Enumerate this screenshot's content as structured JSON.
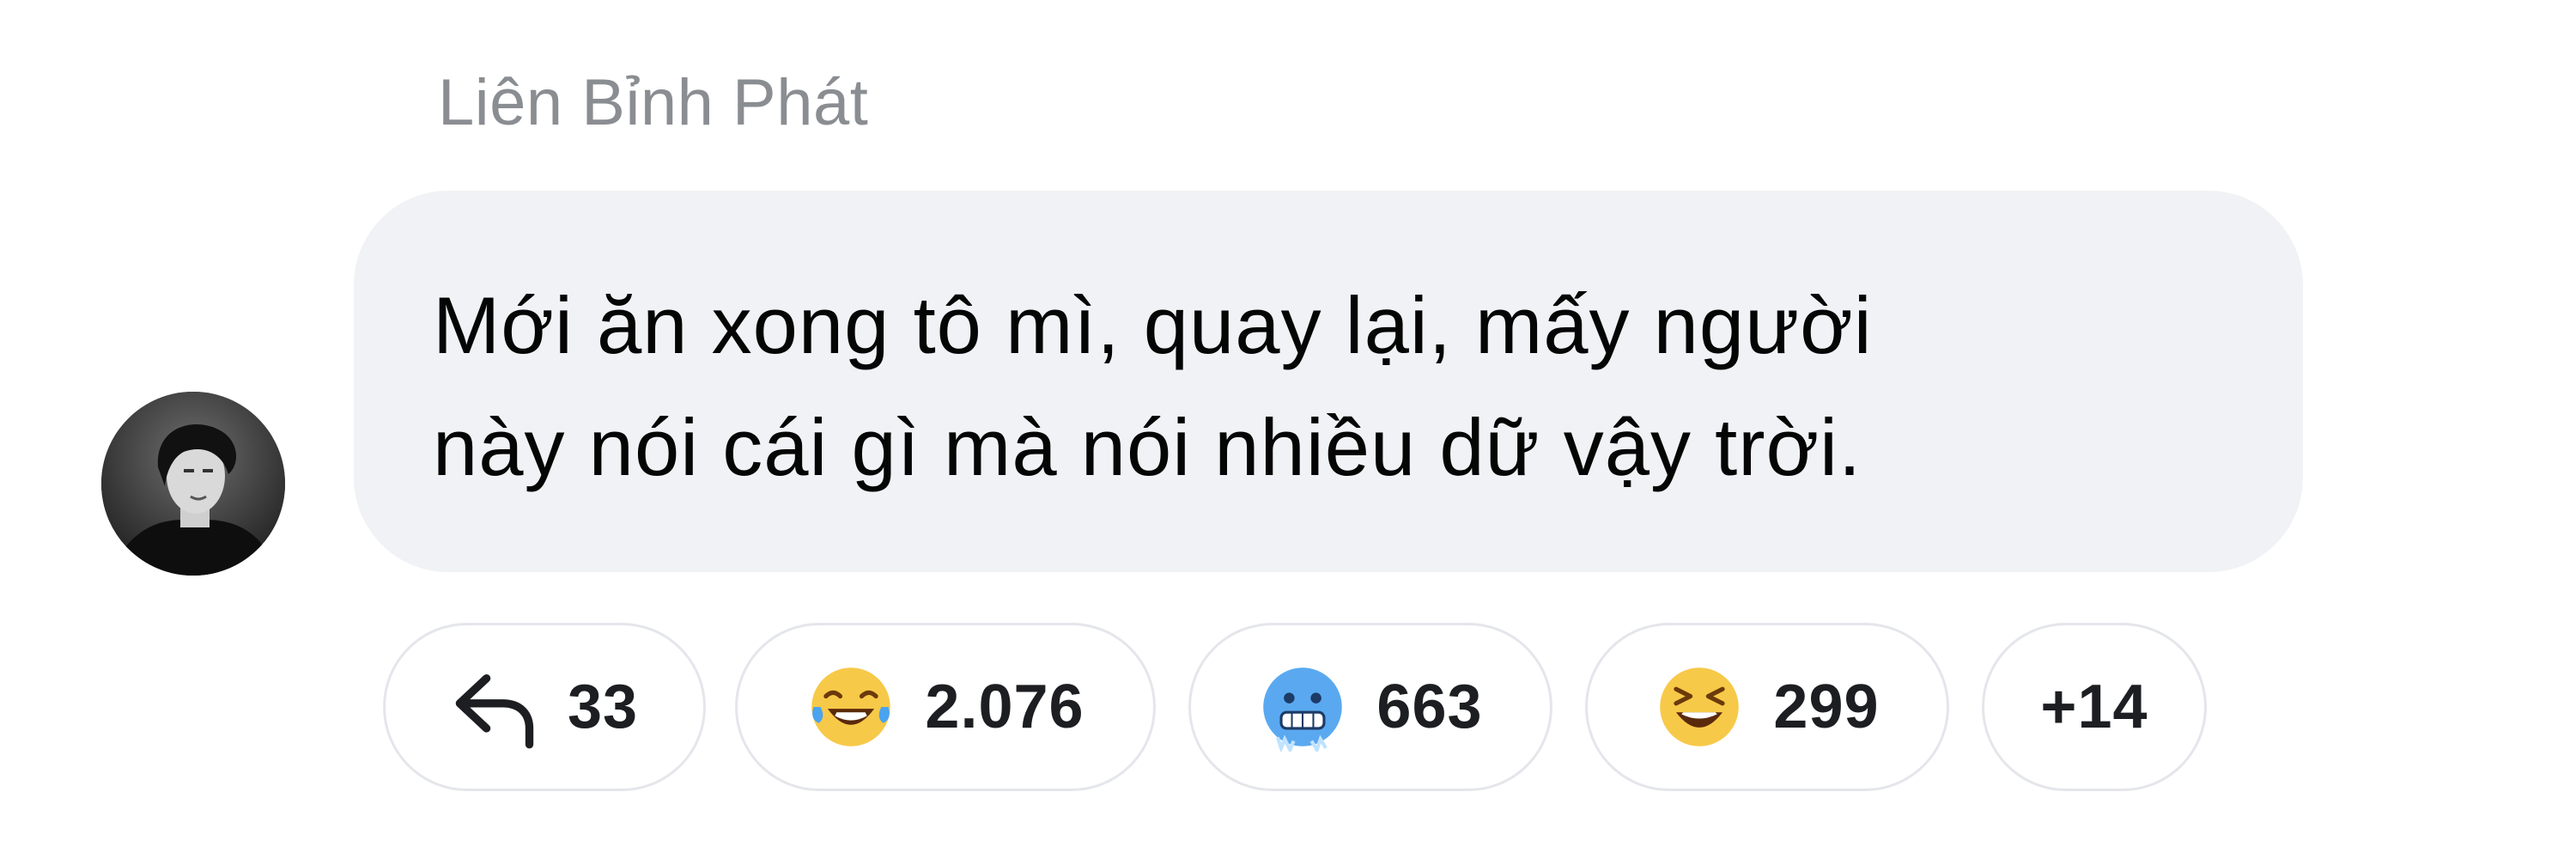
{
  "comment": {
    "author": "Liên Bỉnh Phát",
    "text_lines": [
      "Mới ăn xong tô mì, quay lại, mấy người",
      "này nói cái gì mà nói nhiều dữ vậy trời."
    ],
    "avatar_icon": "user-avatar-photo"
  },
  "reactions": {
    "reply": {
      "icon": "reply-arrow-icon",
      "count": "33"
    },
    "items": [
      {
        "icon": "laughing-tears-emoji",
        "count": "2.076"
      },
      {
        "icon": "cold-face-emoji",
        "count": "663"
      },
      {
        "icon": "grinning-squint-emoji",
        "count": "299"
      }
    ],
    "more": "+14"
  },
  "colors": {
    "bubble_bg": "#f0f2f5",
    "author_text": "#8a8d91",
    "body_text": "#050505",
    "pill_border": "#e4e6eb"
  }
}
